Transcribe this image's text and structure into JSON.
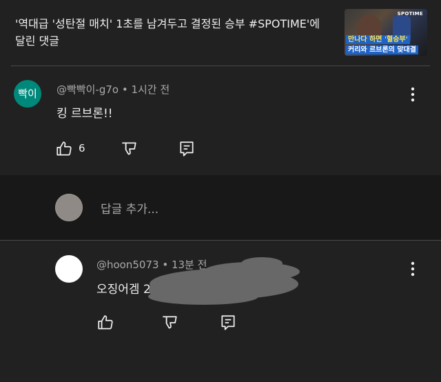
{
  "header": {
    "title": "'역대급 '성탄절 매치' 1초를 남겨두고 결정된 승부 #SPOTIME'에 달린 댓글",
    "thumbnail": {
      "brand": "SPOTIME",
      "caption_line1": "만나다 하면 '혈승부'",
      "caption_line2": "커리와 르브론의 맞대결"
    }
  },
  "comment1": {
    "avatar_text": "빡이",
    "avatar_color": "#00897b",
    "author": "@빡빡이-g7o",
    "time": "1시간 전",
    "text": "킹 르브론!!",
    "like_count": "6",
    "icons": [
      "thumb-up-icon",
      "thumb-down-icon",
      "reply-icon",
      "more-vert-icon"
    ]
  },
  "reply_input": {
    "placeholder": "답글 추가..."
  },
  "comment2": {
    "author": "@hoon5073",
    "time": "13분 전",
    "text": "오징어겜 2",
    "icons": [
      "thumb-up-icon",
      "thumb-down-icon",
      "reply-icon",
      "more-vert-icon"
    ]
  }
}
